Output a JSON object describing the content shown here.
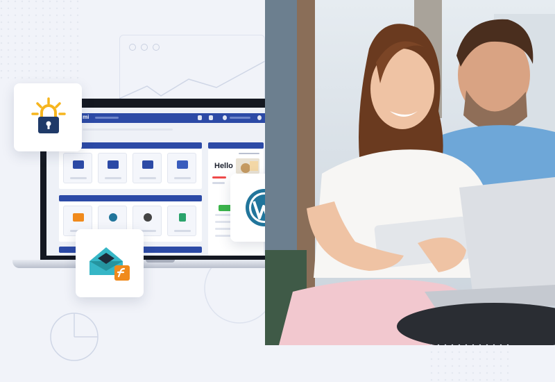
{
  "app": {
    "brand": "mi",
    "hello_text": "Hello"
  },
  "cards": {
    "lock_icon": "lock-icon",
    "wordpress_icon": "wordpress-icon",
    "mail_icon": "mail-icon"
  },
  "colors": {
    "background": "#f1f3f9",
    "app_header": "#2c4aa6",
    "accent_orange": "#f08a1c",
    "wordpress_blue": "#21759b",
    "lock_yellow": "#f6b51e",
    "lock_navy": "#1f3a68",
    "mail_teal": "#36b6c6"
  }
}
